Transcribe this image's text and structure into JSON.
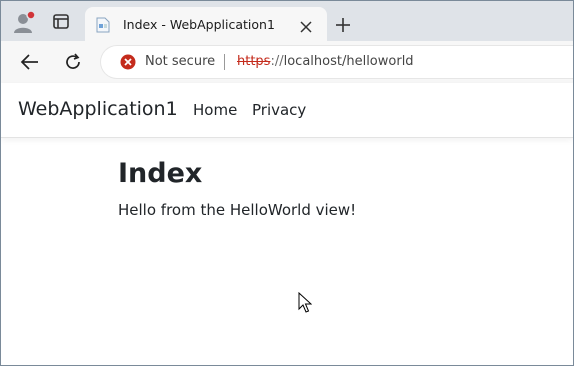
{
  "browser": {
    "tab": {
      "title": "Index - WebApplication1",
      "favicon": "page-icon"
    },
    "toolbar": {
      "security_status": "Not secure",
      "url_scheme": "https",
      "url_separator": "://",
      "url_rest": "localhost/helloworld"
    },
    "colors": {
      "accent_warning": "#c42b1c"
    }
  },
  "page": {
    "navbar": {
      "brand": "WebApplication1",
      "links": [
        {
          "label": "Home"
        },
        {
          "label": "Privacy"
        }
      ]
    },
    "main": {
      "heading": "Index",
      "message": "Hello from the HelloWorld view!"
    }
  }
}
